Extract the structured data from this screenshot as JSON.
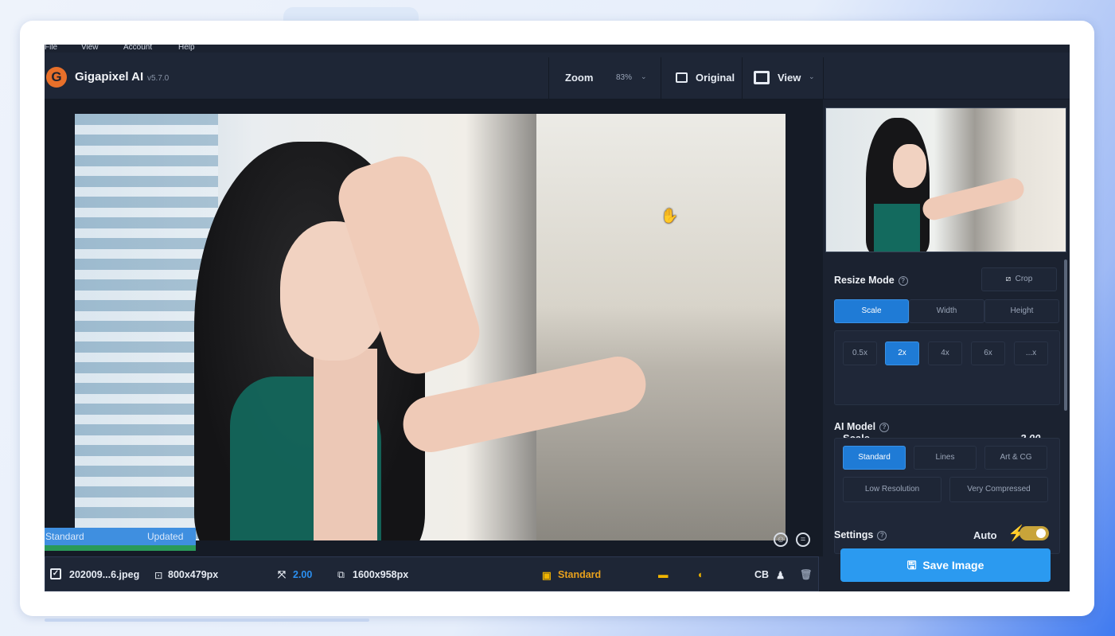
{
  "menu": {
    "file": "File",
    "view": "View",
    "account": "Account",
    "help": "Help"
  },
  "app": {
    "name": "Gigapixel AI",
    "version": "v5.7.0",
    "logo_letter": "G"
  },
  "toolbar": {
    "zoom_label": "Zoom",
    "zoom_value": "83%",
    "original_label": "Original",
    "view_label": "View"
  },
  "status": {
    "model": "Standard",
    "state": "Updated"
  },
  "bottom": {
    "filename": "202009...6.jpeg",
    "input_size": "800x479px",
    "scale": "2.00",
    "output_size": "1600x958px",
    "model": "Standard",
    "cb": "CB"
  },
  "panel": {
    "resize_mode_label": "Resize Mode",
    "crop_label": "Crop",
    "resize_tabs": [
      "Scale",
      "Width",
      "Height"
    ],
    "scale_options": [
      "0.5x",
      "2x",
      "4x",
      "6x",
      "...x"
    ],
    "scale_label": "Scale",
    "scale_value": "2.00",
    "ai_model_label": "AI Model",
    "ai_models_row1": [
      "Standard",
      "Lines",
      "Art & CG"
    ],
    "ai_models_row2": [
      "Low Resolution",
      "Very Compressed"
    ],
    "settings_label": "Settings",
    "auto_label": "Auto",
    "save_label": "Save Image"
  },
  "colors": {
    "accent": "#1f7bd6",
    "save": "#2b9af0",
    "warning": "#f0b400"
  },
  "icons": [
    "gigapixel-logo-icon",
    "original-icon",
    "view-icon",
    "crop-icon",
    "hand-cursor-icon",
    "face-icon",
    "compare-icon",
    "scale-icon",
    "output-icon",
    "model-icon",
    "lightning-icon",
    "save-icon",
    "person-icon",
    "trash-icon"
  ]
}
